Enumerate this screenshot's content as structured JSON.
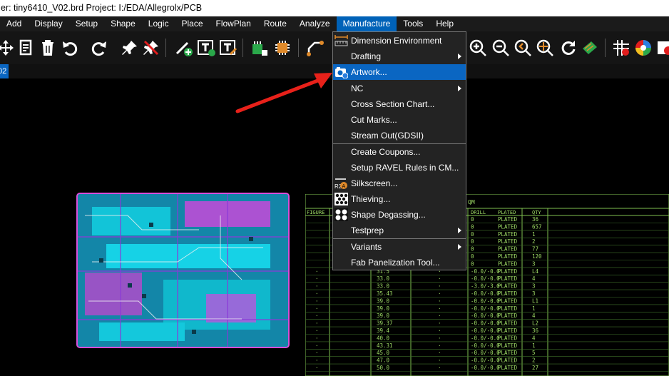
{
  "window": {
    "title": "er: tiny6410_V02.brd  Project: I:/EDA/Allegrolx/PCB"
  },
  "menubar": {
    "items": [
      "Add",
      "Display",
      "Setup",
      "Shape",
      "Logic",
      "Place",
      "FlowPlan",
      "Route",
      "Analyze",
      "Manufacture",
      "Tools",
      "Help"
    ],
    "active": "Manufacture"
  },
  "tab": {
    "label": "02"
  },
  "manufacture_menu": {
    "items": [
      {
        "label": "Dimension Environment",
        "icon": "dimension-icon"
      },
      {
        "label": "Drafting",
        "submenu": true
      },
      {
        "label": "Artwork...",
        "icon": "artwork-icon",
        "highlighted": true
      },
      {
        "label": "NC",
        "submenu": true
      },
      {
        "label": "Cross Section Chart..."
      },
      {
        "label": "Cut Marks..."
      },
      {
        "label": "Stream Out(GDSII)"
      },
      {
        "label": "Create Coupons..."
      },
      {
        "label": "Setup RAVEL Rules in CM..."
      },
      {
        "label": "Silkscreen...",
        "icon": "silkscreen-icon"
      },
      {
        "label": "Thieving...",
        "icon": "thieving-icon"
      },
      {
        "label": "Shape Degassing...",
        "icon": "degassing-icon"
      },
      {
        "label": "Testprep",
        "submenu": true
      },
      {
        "label": "Variants",
        "submenu": true
      },
      {
        "label": "Fab Panelization Tool..."
      }
    ]
  },
  "drill_table": {
    "header_fragment": "QM",
    "columns": [
      "FIGURE",
      "",
      "",
      "DRILL",
      "PLATED",
      "QTY"
    ],
    "rows": [
      [
        "",
        "",
        "",
        "0",
        "PLATED",
        "36"
      ],
      [
        "",
        "",
        "",
        "0",
        "PLATED",
        "657"
      ],
      [
        "",
        "",
        "",
        "0",
        "PLATED",
        "1"
      ],
      [
        "",
        "",
        "",
        "0",
        "PLATED",
        "2"
      ],
      [
        "",
        "",
        "",
        "0",
        "PLATED",
        "77"
      ],
      [
        "",
        "",
        "",
        "0",
        "PLATED",
        "120"
      ],
      [
        "",
        "",
        "",
        "0",
        "PLATED",
        "3"
      ],
      [
        "·",
        "31.5",
        "·",
        "-0.0/-0.0",
        "PLATED",
        "L4"
      ],
      [
        "·",
        "33.0",
        "·",
        "-0.0/-0.0",
        "PLATED",
        "4"
      ],
      [
        "·",
        "33.0",
        "·",
        "-3.0/-3.0",
        "PLATED",
        "3"
      ],
      [
        "·",
        "35.43",
        "·",
        "-0.0/-0.0",
        "PLATED",
        "3"
      ],
      [
        "·",
        "39.0",
        "·",
        "-0.0/-0.0",
        "PLATED",
        "L1"
      ],
      [
        "·",
        "39.0",
        "·",
        "-0.0/-0.0",
        "PLATED",
        "1"
      ],
      [
        "·",
        "39.0",
        "·",
        "-0.0/-0.0",
        "PLATED",
        "4"
      ],
      [
        "·",
        "39.37",
        "·",
        "-0.0/-0.0",
        "PLATED",
        "L2"
      ],
      [
        "·",
        "39.4",
        "·",
        "-0.0/-0.0",
        "PLATED",
        "36"
      ],
      [
        "·",
        "40.0",
        "·",
        "-0.0/-0.0",
        "PLATED",
        "4"
      ],
      [
        "·",
        "43.31",
        "·",
        "-0.0/-0.0",
        "PLATED",
        "1"
      ],
      [
        "·",
        "45.0",
        "·",
        "-0.0/-0.0",
        "PLATED",
        "5"
      ],
      [
        "·",
        "47.0",
        "·",
        "-0.0/-0.0",
        "PLATED",
        "2"
      ],
      [
        "·",
        "50.0",
        "·",
        "-0.0/-0.0",
        "PLATED",
        "27"
      ]
    ]
  },
  "colors": {
    "menu_highlight": "#0a66c2",
    "annotation_arrow": "#e8211a",
    "board_outline": "#d94fd9",
    "table_text": "#9fdc66"
  }
}
